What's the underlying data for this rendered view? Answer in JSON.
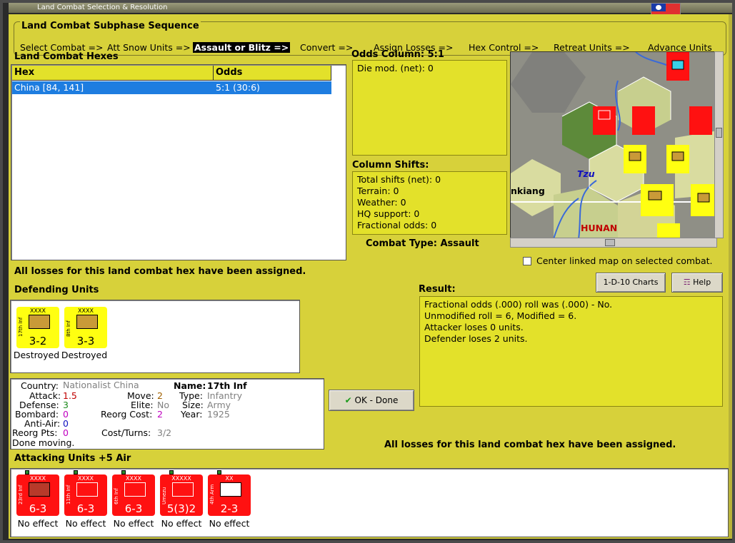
{
  "window": {
    "title": "Land Combat Selection & Resolution"
  },
  "sequence": {
    "label": "Land Combat Subphase Sequence",
    "steps": [
      "Select Combat =>",
      "Att Snow Units =>",
      "Assault or Blitz =>",
      "Convert =>",
      "Assign Losses =>",
      "Hex Control =>",
      "Retreat Units =>",
      "Advance Units"
    ],
    "current_index": 2
  },
  "hexes": {
    "label": "Land Combat Hexes",
    "columns": [
      "Hex",
      "Odds"
    ],
    "rows": [
      {
        "hex": "China [84, 141]",
        "odds": "5:1 (30:6)"
      }
    ]
  },
  "odds": {
    "label": "Odds Column: 5:1",
    "die_mod": "Die mod. (net): 0"
  },
  "shifts": {
    "label": "Column Shifts:",
    "lines": [
      "Total shifts (net): 0",
      "Terrain: 0",
      "Weather: 0",
      "HQ support: 0",
      "Fractional odds: 0"
    ]
  },
  "combat_type": "Combat Type:  Assault",
  "map": {
    "labels": [
      "Tzu",
      "nkiang",
      "HUNAN"
    ],
    "center_label": "Center linked map on selected combat."
  },
  "losses_msg_top": "All losses for this land combat hex have been assigned.",
  "buttons": {
    "charts": "1-D-10 Charts",
    "help": "Help",
    "ok": "OK - Done"
  },
  "defending": {
    "label": "Defending Units",
    "units": [
      {
        "name": "17th Inf",
        "size": "XXXX",
        "value": "3-2",
        "status": "Destroyed"
      },
      {
        "name": "8th Inf",
        "size": "XXXX",
        "value": "3-3",
        "status": "Destroyed"
      }
    ]
  },
  "result": {
    "label": "Result:",
    "lines": [
      "Fractional odds (.000) roll was (.000)  - No.",
      "Unmodified roll = 6, Modified = 6.",
      "Attacker loses 0 units.",
      "Defender loses 2 units."
    ]
  },
  "info": {
    "country_k": "Country:",
    "country_v": "Nationalist China",
    "attack_k": "Attack:",
    "attack_v": "1.5",
    "defense_k": "Defense:",
    "defense_v": "3",
    "bombard_k": "Bombard:",
    "bombard_v": "0",
    "antiair_k": "Anti-Air:",
    "antiair_v": "0",
    "reorgpts_k": "Reorg Pts:",
    "reorgpts_v": "0",
    "move_k": "Move:",
    "move_v": "2",
    "elite_k": "Elite:",
    "elite_v": "No",
    "reorgcost_k": "Reorg Cost:",
    "reorgcost_v": "2",
    "costturns_k": "Cost/Turns:",
    "costturns_v": "3/2",
    "name_k": "Name:",
    "name_v": "17th Inf",
    "type_k": "Type:",
    "type_v": "Infantry",
    "size_k": "Size:",
    "size_v": "Army",
    "year_k": "Year:",
    "year_v": "1925",
    "status": "Done moving."
  },
  "losses_msg_bottom": "All losses for this land combat hex have been assigned.",
  "attacking": {
    "label": "Attacking Units +5 Air",
    "units": [
      {
        "name": "23rd Inf",
        "size": "XXXX",
        "value": "6-3",
        "status": "No effect"
      },
      {
        "name": "11th Inf",
        "size": "XXXX",
        "value": "6-3",
        "status": "No effect"
      },
      {
        "name": "6th Inf",
        "size": "XXXX",
        "value": "6-3",
        "status": "No effect"
      },
      {
        "name": "Umezu",
        "size": "XXXXX",
        "value": "5(3)2",
        "status": "No effect"
      },
      {
        "name": "4th Arm",
        "size": "XX",
        "value": "2-3",
        "status": "No effect"
      }
    ]
  },
  "colors": {
    "panel": "#d7d13a",
    "selection": "#1e7de0",
    "unit_red": "#ff1111",
    "unit_yellow": "#ffff11"
  }
}
